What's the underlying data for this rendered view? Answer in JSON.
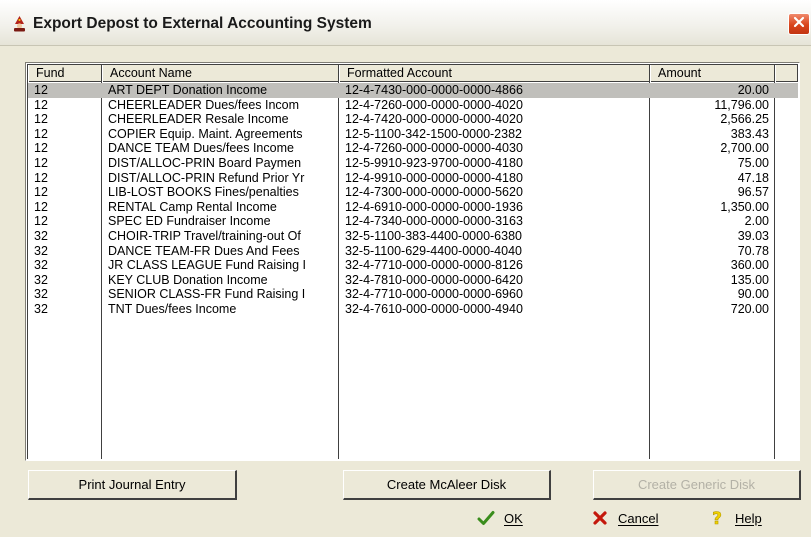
{
  "window": {
    "title": "Export Depost to External Accounting System"
  },
  "grid": {
    "columns": [
      "Fund",
      "Account Name",
      "Formatted Account",
      "Amount"
    ],
    "rows": [
      {
        "fund": "12",
        "name": "ART DEPT Donation Income",
        "account": "12-4-7430-000-0000-0000-4866",
        "amount": "20.00",
        "selected": true
      },
      {
        "fund": "12",
        "name": "CHEERLEADER Dues/fees Incom",
        "account": "12-4-7260-000-0000-0000-4020",
        "amount": "11,796.00"
      },
      {
        "fund": "12",
        "name": "CHEERLEADER Resale Income",
        "account": "12-4-7420-000-0000-0000-4020",
        "amount": "2,566.25"
      },
      {
        "fund": "12",
        "name": "COPIER Equip. Maint. Agreements",
        "account": "12-5-1100-342-1500-0000-2382",
        "amount": "383.43"
      },
      {
        "fund": "12",
        "name": "DANCE TEAM Dues/fees Income",
        "account": "12-4-7260-000-0000-0000-4030",
        "amount": "2,700.00"
      },
      {
        "fund": "12",
        "name": "DIST/ALLOC-PRIN Board Paymen",
        "account": "12-5-9910-923-9700-0000-4180",
        "amount": "75.00"
      },
      {
        "fund": "12",
        "name": "DIST/ALLOC-PRIN Refund Prior Yr",
        "account": "12-4-9910-000-0000-0000-4180",
        "amount": "47.18"
      },
      {
        "fund": "12",
        "name": "LIB-LOST BOOKS Fines/penalties",
        "account": "12-4-7300-000-0000-0000-5620",
        "amount": "96.57"
      },
      {
        "fund": "12",
        "name": "RENTAL Camp Rental Income",
        "account": "12-4-6910-000-0000-0000-1936",
        "amount": "1,350.00"
      },
      {
        "fund": "12",
        "name": "SPEC ED Fundraiser Income",
        "account": "12-4-7340-000-0000-0000-3163",
        "amount": "2.00"
      },
      {
        "fund": "32",
        "name": "CHOIR-TRIP Travel/training-out Of",
        "account": "32-5-1100-383-4400-0000-6380",
        "amount": "39.03"
      },
      {
        "fund": "32",
        "name": "DANCE TEAM-FR Dues And Fees",
        "account": "32-5-1100-629-4400-0000-4040",
        "amount": "70.78"
      },
      {
        "fund": "32",
        "name": "JR CLASS LEAGUE Fund Raising I",
        "account": "32-4-7710-000-0000-0000-8126",
        "amount": "360.00"
      },
      {
        "fund": "32",
        "name": "KEY CLUB Donation Income",
        "account": "32-4-7810-000-0000-0000-6420",
        "amount": "135.00"
      },
      {
        "fund": "32",
        "name": "SENIOR CLASS-FR Fund Raising I",
        "account": "32-4-7710-000-0000-0000-6960",
        "amount": "90.00"
      },
      {
        "fund": "32",
        "name": "TNT Dues/fees Income",
        "account": "32-4-7610-000-0000-0000-4940",
        "amount": "720.00"
      }
    ]
  },
  "buttons": {
    "print_journal": "Print Journal Entry",
    "create_mcaleer": "Create McAleer Disk",
    "create_generic": "Create Generic Disk"
  },
  "actions": {
    "ok": "OK",
    "cancel": "Cancel",
    "help": "Help"
  },
  "icons": {
    "app": "wizard-app-icon",
    "close": "close-icon",
    "ok": "checkmark-icon",
    "cancel": "x-mark-icon",
    "help": "question-mark-icon"
  },
  "colors": {
    "close": "#d9441c",
    "ok_check": "#3a8d1c",
    "cancel_x": "#c4180c",
    "help_q": "#f2d200",
    "selected_row": "#c0bfbb"
  }
}
